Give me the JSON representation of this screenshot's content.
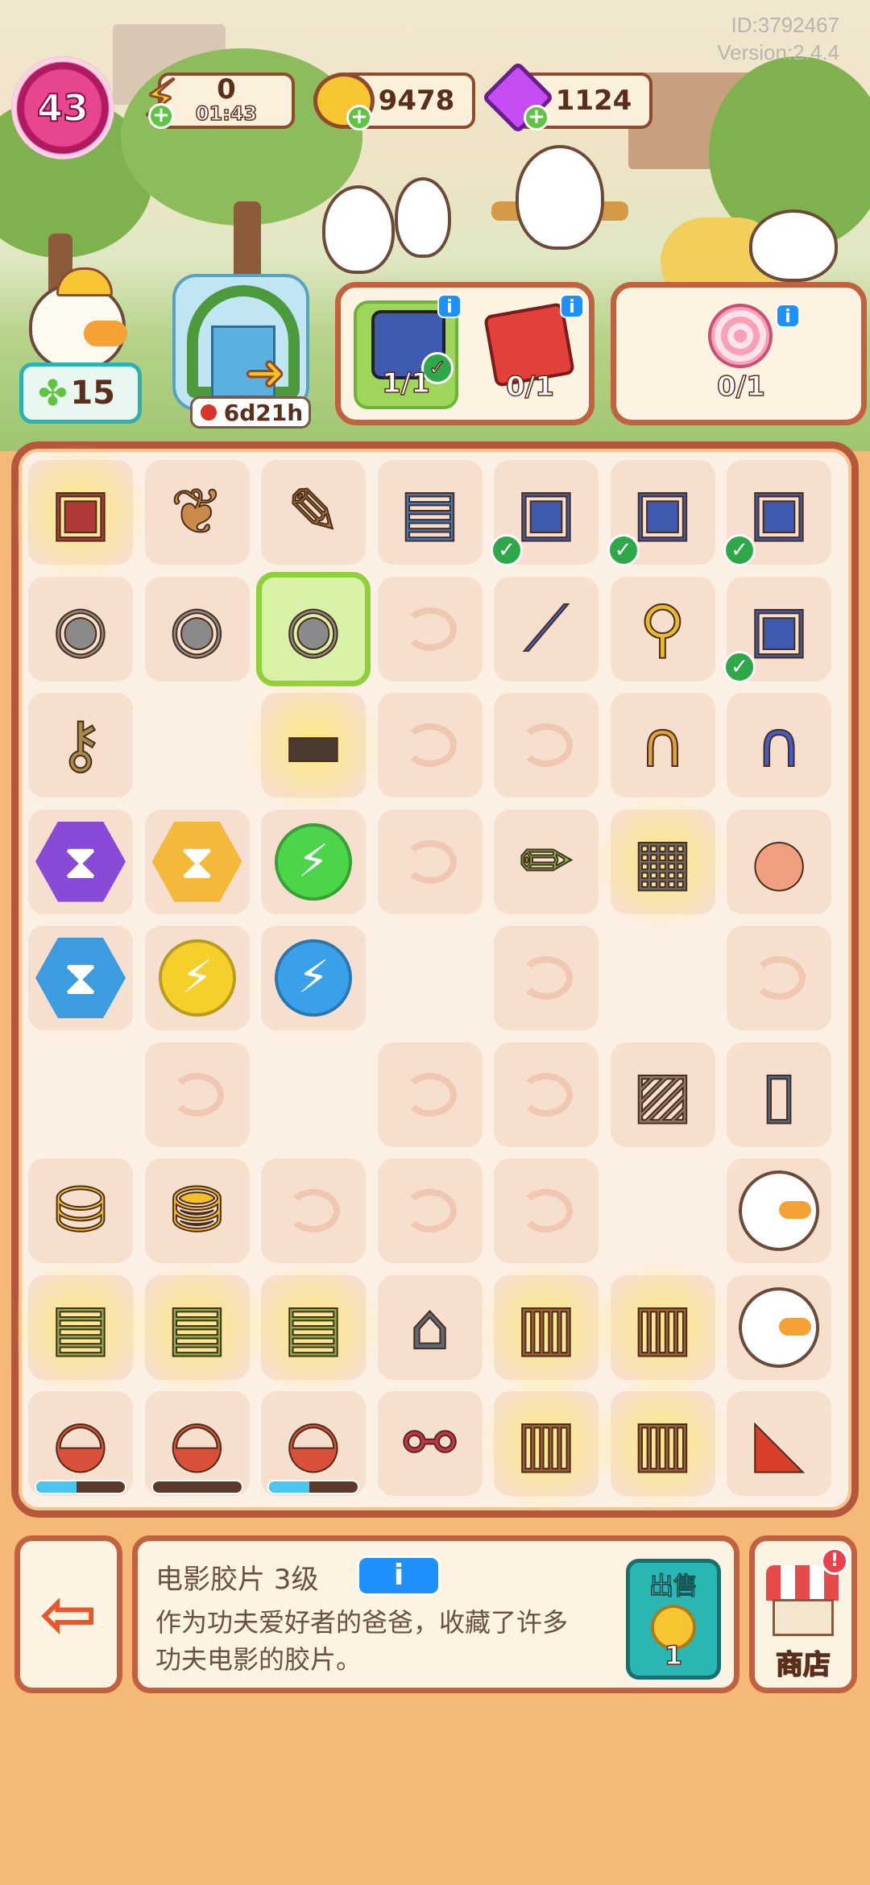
{
  "header": {
    "player_id": "ID:3792467",
    "version": "Version:2.4.4",
    "level": "43",
    "energy": {
      "icon": "lightning-icon",
      "value": "0",
      "timer": "01:43"
    },
    "coins": {
      "icon": "coin-icon",
      "value": "9478"
    },
    "gems": {
      "icon": "gem-icon",
      "value": "1124"
    }
  },
  "character": {
    "icon": "duck-worker-icon",
    "stars": "15"
  },
  "event": {
    "icon": "event-garden-gate-icon",
    "timer": "6d21h"
  },
  "orders": [
    {
      "items": [
        {
          "icon": "speaker-box-icon",
          "progress": "1/1",
          "done": true
        },
        {
          "icon": "book-icon",
          "progress": "0/1",
          "done": false
        }
      ]
    },
    {
      "items": [
        {
          "icon": "lollipop-icon",
          "progress": "0/1",
          "done": false
        }
      ]
    }
  ],
  "board": {
    "cols": 7,
    "rows": 9,
    "cells": [
      [
        "generator-tv",
        "map-scroll",
        "wood-scroll",
        "book-bundle",
        "speaker-box-done",
        "speaker-box-done",
        "speaker-box-done"
      ],
      [
        "film-reel",
        "film-reel",
        "film-reel-selected",
        "locked",
        "ladder-slide",
        "exercise-bike",
        "speaker-box-done"
      ],
      [
        "key-scepter",
        "empty",
        "generator-chest",
        "locked",
        "locked",
        "rope-barrier",
        "rope-post"
      ],
      [
        "hourglass-purple",
        "hourglass-gold",
        "energy-green",
        "locked",
        "pencil",
        "generator-toolbox",
        "plasma-ball"
      ],
      [
        "hourglass-blue",
        "energy-yellow",
        "energy-blue",
        "empty",
        "locked",
        "empty",
        "locked"
      ],
      [
        "empty",
        "locked",
        "empty",
        "locked",
        "locked",
        "photo-frames",
        "poster-board"
      ],
      [
        "coin-pile",
        "coin-stack",
        "locked",
        "locked",
        "locked",
        "empty",
        "duck-ninja"
      ],
      [
        "generator-books",
        "generator-books",
        "generator-books",
        "house-timer",
        "generator-fence",
        "generator-fence",
        "duck-angel"
      ],
      [
        "generator-stage",
        "generator-stage",
        "generator-stage",
        "nunchaku",
        "generator-fence",
        "generator-fence",
        "pennant-no1"
      ]
    ],
    "stage_progress": [
      0.45,
      0.0,
      0.45
    ]
  },
  "selected_item": {
    "name": "电影胶片 3级",
    "info_label": "i",
    "description": "作为功夫爱好者的爸爸，收藏了许多功夫电影的胶片。",
    "sell_label": "出售",
    "sell_price": "1"
  },
  "bottom": {
    "exit_icon": "exit-icon",
    "shop_label": "商店",
    "shop_alert": "!"
  },
  "colors": {
    "frame": "#c2613f",
    "board_border": "#b6573c",
    "accent": "#2ab7b3"
  }
}
